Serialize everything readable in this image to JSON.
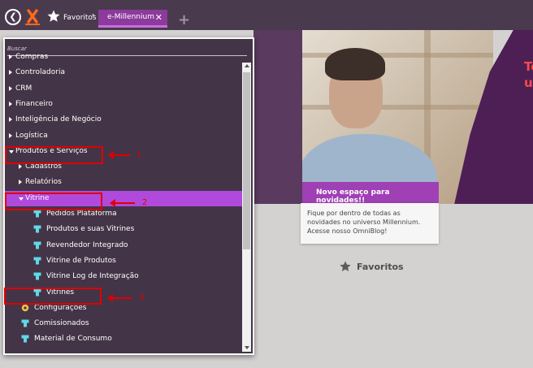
{
  "topbar": {
    "favorites_label": "Favoritos",
    "tab_label": "e-Millennium",
    "tab_close": "✕",
    "add_tab": "+"
  },
  "banner": {
    "text_line1": "Te",
    "text_line2": "um",
    "news_title": "Novo espaço para novidades!!",
    "news_body": "Fique por dentro de todas as novidades no universo Millennium. Acesse nosso OmniBlog!"
  },
  "favorites_heading": "Favoritos",
  "menu": {
    "search_placeholder": "Buscar",
    "items": [
      {
        "label": "Compras",
        "level": 0,
        "kind": "folder",
        "expanded": false
      },
      {
        "label": "Controladoria",
        "level": 0,
        "kind": "folder",
        "expanded": false
      },
      {
        "label": "CRM",
        "level": 0,
        "kind": "folder",
        "expanded": false
      },
      {
        "label": "Financeiro",
        "level": 0,
        "kind": "folder",
        "expanded": false
      },
      {
        "label": "Inteligência de Negócio",
        "level": 0,
        "kind": "folder",
        "expanded": false
      },
      {
        "label": "Logística",
        "level": 0,
        "kind": "folder",
        "expanded": false
      },
      {
        "label": "Produtos e Serviços",
        "level": 0,
        "kind": "folder",
        "expanded": true
      },
      {
        "label": "Cadastros",
        "level": 1,
        "kind": "folder",
        "expanded": false
      },
      {
        "label": "Relatórios",
        "level": 1,
        "kind": "folder",
        "expanded": false
      },
      {
        "label": "Vitrine",
        "level": 1,
        "kind": "folder",
        "expanded": true,
        "active": true
      },
      {
        "label": "Pedidos Plataforma",
        "level": 2,
        "kind": "leaf"
      },
      {
        "label": "Produtos e suas Vitrines",
        "level": 2,
        "kind": "leaf"
      },
      {
        "label": "Revendedor Integrado",
        "level": 2,
        "kind": "leaf"
      },
      {
        "label": "Vitrine de Produtos",
        "level": 2,
        "kind": "leaf"
      },
      {
        "label": "Vitrine Log de Integração",
        "level": 2,
        "kind": "leaf"
      },
      {
        "label": "Vitrines",
        "level": 2,
        "kind": "leaf"
      },
      {
        "label": "Configurações",
        "level": 1,
        "kind": "special"
      },
      {
        "label": "Comissionados",
        "level": 1,
        "kind": "leaf"
      },
      {
        "label": "Material de Consumo",
        "level": 1,
        "kind": "leaf"
      }
    ]
  },
  "annotations": [
    "1",
    "2",
    "3"
  ],
  "colors": {
    "topbar_bg": "#4a3a4e",
    "tab_bg": "#8c3a9c",
    "menu_bg": "#443447",
    "active_item": "#b04adc",
    "leaf_icon": "#5fd8e8",
    "annotation": "#e00000",
    "banner_text": "#ff4a4a"
  }
}
